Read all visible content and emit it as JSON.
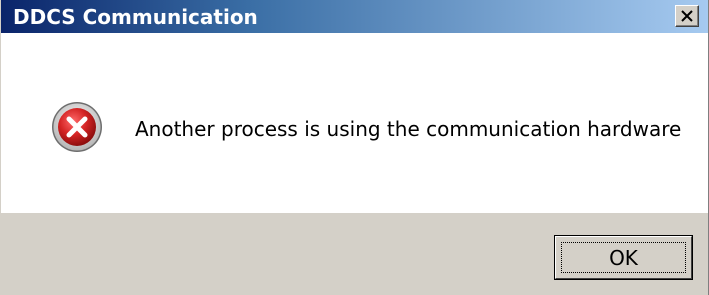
{
  "window": {
    "title": "DDCS Communication",
    "close_label": "×"
  },
  "dialog": {
    "icon": "error-icon",
    "message": "Another process is using the communication hardware"
  },
  "buttons": {
    "ok_label": "OK"
  },
  "colors": {
    "titlebar_start": "#0a246a",
    "titlebar_end": "#a6caf0",
    "error_red": "#c81e1e",
    "button_face": "#d4d0c8"
  }
}
